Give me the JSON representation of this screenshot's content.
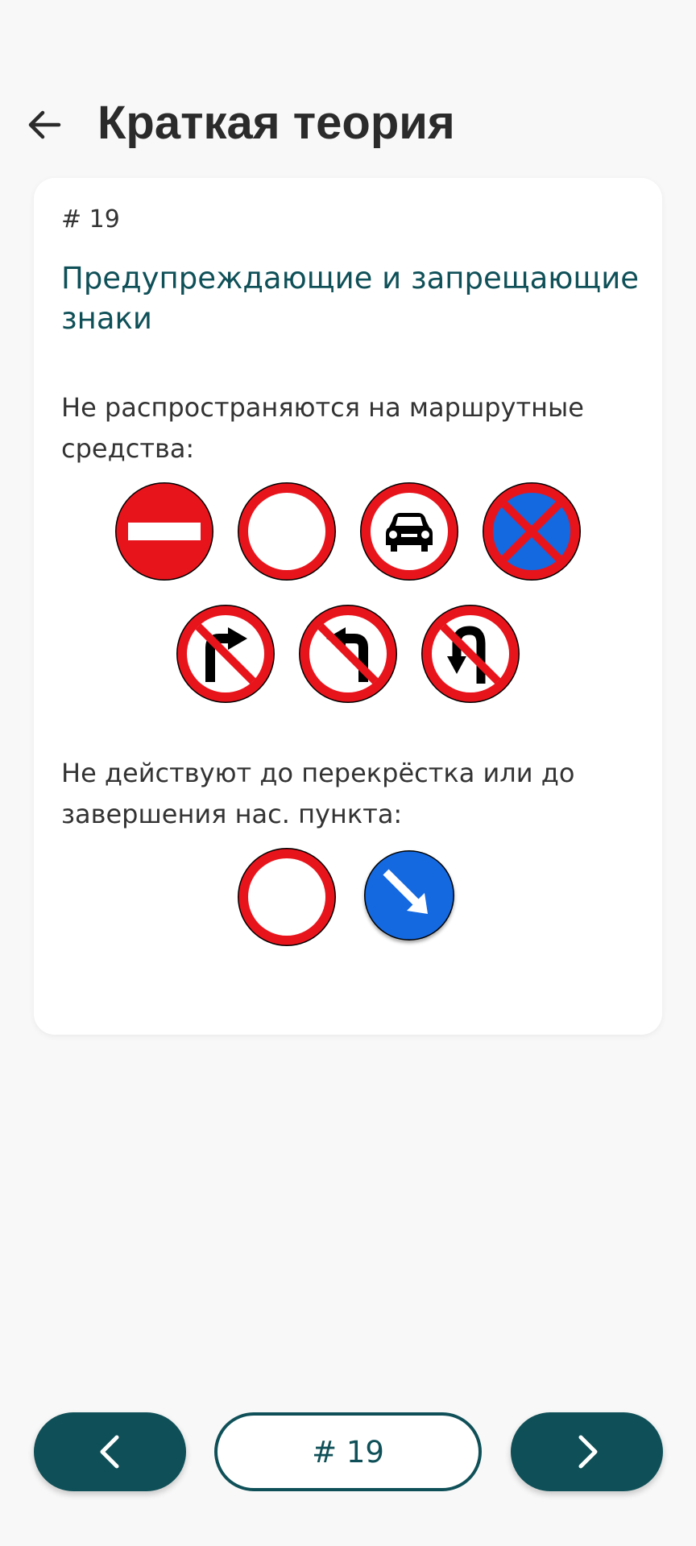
{
  "header": {
    "title": "Краткая теория",
    "back_icon": "arrow-left-icon"
  },
  "card": {
    "number": "# 19",
    "heading": "Предупреждающие и запрещающие знаки",
    "section1": {
      "text": "Не распространяются на маршрутные средства:",
      "signs_row1": [
        "no-entry-sign-icon",
        "no-vehicles-sign-icon",
        "no-cars-sign-icon",
        "no-stopping-sign-icon"
      ],
      "signs_row2": [
        "no-right-turn-sign-icon",
        "no-left-turn-sign-icon",
        "no-u-turn-sign-icon"
      ]
    },
    "section2": {
      "text": "Не действуют до перекрёстка или до завершения нас. пункта:",
      "signs": [
        "no-vehicles-sign-icon",
        "keep-right-sign-icon"
      ]
    }
  },
  "bottom_nav": {
    "prev_icon": "chevron-left-icon",
    "page_label": "# 19",
    "next_icon": "chevron-right-icon"
  },
  "colors": {
    "primary": "#0f5058",
    "sign_red": "#e8141c",
    "sign_blue": "#1468e0",
    "background": "#f8f8f8"
  }
}
